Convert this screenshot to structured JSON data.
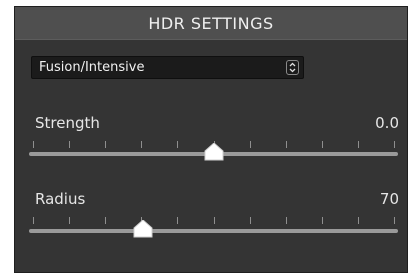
{
  "panel": {
    "title": "HDR SETTINGS"
  },
  "mode_select": {
    "value": "Fusion/Intensive"
  },
  "strength": {
    "label": "Strength",
    "value_text": "0.0",
    "level": 0.5
  },
  "radius": {
    "label": "Radius",
    "value_text": "70",
    "level": 0.31
  },
  "colors": {
    "panel_bg": "#343434",
    "header_bg": "#4f4f4f",
    "track": "#9a9a9a",
    "thumb": "#ffffff"
  },
  "icons": {
    "select_chevron": "chevron-up-down-icon",
    "thumb": "slider-thumb"
  }
}
